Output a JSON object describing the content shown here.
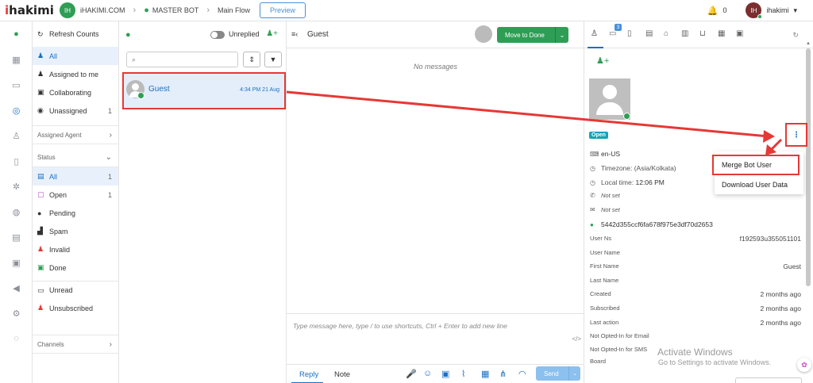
{
  "topbar": {
    "logo": "hakimi",
    "workspace_initials": "IH",
    "workspace_name": "iHAKIMI.COM",
    "bot_name": "MASTER BOT",
    "flow_name": "Main Flow",
    "preview_label": "Preview",
    "notification_count": "0",
    "user_initials": "IH",
    "user_name": "ihakimi"
  },
  "filters": {
    "refresh_label": "Refresh Counts",
    "items": [
      {
        "label": "All",
        "count": ""
      },
      {
        "label": "Assigned to me",
        "count": ""
      },
      {
        "label": "Collaborating",
        "count": ""
      },
      {
        "label": "Unassigned",
        "count": "1"
      }
    ],
    "assigned_agent_label": "Assigned Agent",
    "status_label": "Status",
    "status_items": [
      {
        "label": "All",
        "count": "1"
      },
      {
        "label": "Open",
        "count": "1"
      },
      {
        "label": "Pending",
        "count": ""
      },
      {
        "label": "Spam",
        "count": ""
      },
      {
        "label": "Invalid",
        "count": ""
      },
      {
        "label": "Done",
        "count": ""
      }
    ],
    "extra_items": [
      {
        "label": "Unread"
      },
      {
        "label": "Unsubscribed"
      }
    ],
    "channels_label": "Channels"
  },
  "convlist": {
    "unreplied_label": "Unreplied",
    "conversation": {
      "name": "Guest",
      "time": "4:34 PM 21 Aug"
    }
  },
  "chat": {
    "title": "Guest",
    "move_to_done_label": "Move to Done",
    "no_messages": "No messages",
    "composer_placeholder": "Type message here, type / to use shortcuts, Ctrl + Enter to add new line",
    "reply_tab": "Reply",
    "note_tab": "Note",
    "send_label": "Send"
  },
  "rpanel": {
    "tab_badge": "3",
    "status_badge": "Open",
    "menu": {
      "merge_label": "Merge Bot User",
      "download_label": "Download User Data"
    },
    "locale": "en-US",
    "timezone": "Timezone: (Asia/Kolkata)",
    "local_time_label": "Local time:",
    "local_time": "12:06 PM",
    "phone": "Not set",
    "email": "Not set",
    "user_id": "5442d355ccf6fa678f975e3df70d2653",
    "fields": [
      {
        "label": "User Ns",
        "value": "f192593u355051101"
      },
      {
        "label": "User Name",
        "value": ""
      },
      {
        "label": "First Name",
        "value": "Guest"
      },
      {
        "label": "Last Name",
        "value": ""
      },
      {
        "label": "Created",
        "value": "2 months ago"
      },
      {
        "label": "Subscribed",
        "value": "2 months ago"
      },
      {
        "label": "Last action",
        "value": "2 months ago"
      },
      {
        "label": "Not Opted-In for Email",
        "value": ""
      },
      {
        "label": "Not Opted-In for SMS",
        "value": ""
      },
      {
        "label": "Board",
        "value": ""
      }
    ],
    "watermark_title": "Activate Windows",
    "watermark_sub": "Go to Settings to activate Windows."
  },
  "colors": {
    "brand_green": "#2e9e55",
    "link_blue": "#1a6fc4",
    "annotation_red": "#e53935"
  }
}
